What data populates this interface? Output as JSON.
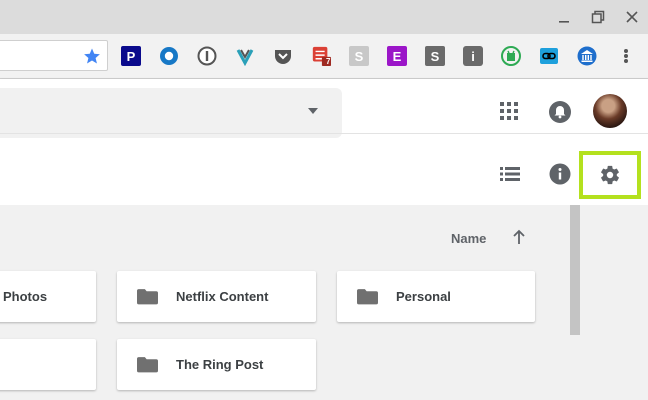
{
  "window": {
    "controls": [
      "minimize-icon",
      "restore-icon",
      "close-icon"
    ]
  },
  "toolbar": {
    "bookmark_icon": "star-icon",
    "bookmark_color": "#4285f4",
    "extensions": [
      {
        "name": "p-extension",
        "glyph": "P",
        "bg": "#0a0a8c"
      },
      {
        "name": "circle-extension",
        "glyph": "",
        "bg": "#1778c6"
      },
      {
        "name": "1password-extension",
        "glyph": "1",
        "bg": "#555555"
      },
      {
        "name": "v-extension",
        "glyph": "V",
        "bg": "#2aa0b8"
      },
      {
        "name": "pocket-extension",
        "glyph": "",
        "bg": "#555555"
      },
      {
        "name": "todoist-extension",
        "glyph": "",
        "bg": "#db4035",
        "badge": "7"
      },
      {
        "name": "s-extension",
        "glyph": "S",
        "bg": "#c8c8c8"
      },
      {
        "name": "e-extension",
        "glyph": "E",
        "bg": "#9b16c8"
      },
      {
        "name": "s-dark-extension",
        "glyph": "S",
        "bg": "#6a6a6a"
      },
      {
        "name": "i-extension",
        "glyph": "i",
        "bg": "#6a6a6a"
      },
      {
        "name": "android-extension",
        "glyph": "",
        "bg": "#2eaa54"
      },
      {
        "name": "link-extension",
        "glyph": "",
        "bg": "#1ea0dc"
      },
      {
        "name": "bank-extension",
        "glyph": "",
        "bg": "#1e6ecc"
      }
    ],
    "menu_icon": "kebab-menu-icon"
  },
  "header": {
    "search_dropdown_icon": "caret-down-icon",
    "apps_icon": "apps-grid-icon",
    "notifications_icon": "bell-icon",
    "list_view_icon": "list-view-icon",
    "info_icon": "info-icon",
    "settings_icon": "gear-icon",
    "highlight_color": "#b4e11e"
  },
  "content": {
    "sort_label": "Name",
    "sort_icon": "arrow-up-icon",
    "folders": [
      {
        "name": "Photos"
      },
      {
        "name": "Netflix Content"
      },
      {
        "name": "Personal"
      },
      {
        "name": ""
      },
      {
        "name": "The Ring Post"
      }
    ]
  }
}
